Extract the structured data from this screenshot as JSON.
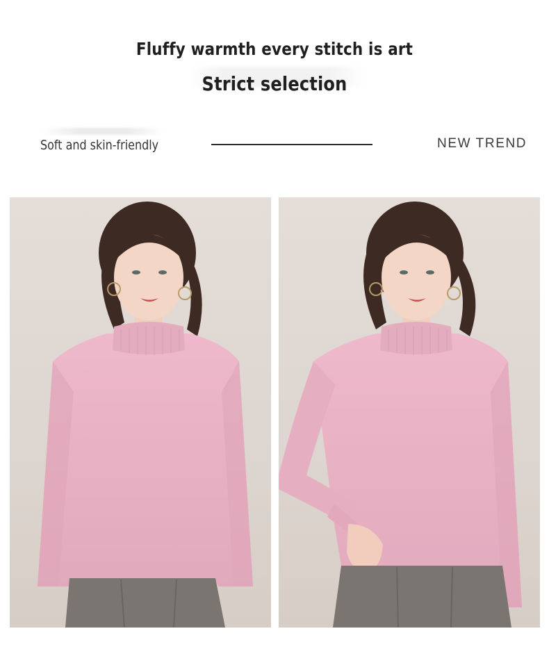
{
  "heading": {
    "line1": "Fluffy warmth every stitch is art",
    "line2": "Strict selection"
  },
  "feature_row": {
    "left_label": "Soft and skin-friendly",
    "right_label": "NEW TREND"
  },
  "photos": [
    {
      "subject": "woman in pink mock-neck sweater, hands down"
    },
    {
      "subject": "woman in pink mock-neck sweater, hand resting"
    }
  ],
  "colors": {
    "sweater": "#eab8c8",
    "backdrop": "#e0d8d2",
    "hair": "#3d2a22",
    "trousers": "#7a7570"
  }
}
